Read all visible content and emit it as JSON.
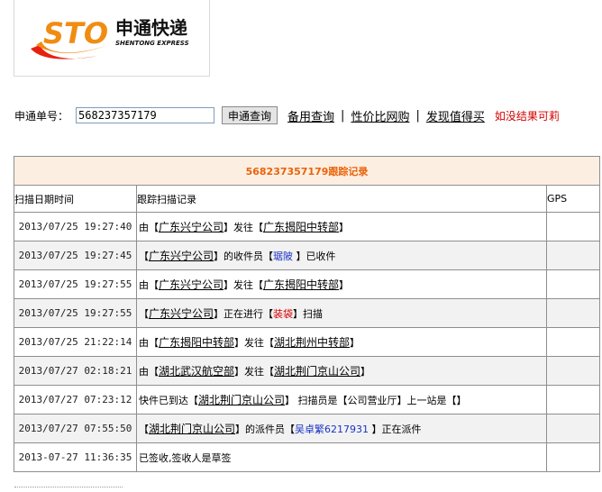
{
  "logo": {
    "mark": "STO",
    "name_cn": "申通快递",
    "name_en": "SHENTONG EXPRESS",
    "colors": {
      "orange": "#f08c12",
      "red": "#e8200f"
    }
  },
  "search": {
    "label": "申通单号：",
    "value": "568237357179",
    "button": "申通查询",
    "links": [
      "备用查询",
      "性价比网购",
      "发现值得买"
    ],
    "separators": [
      "|",
      "|"
    ],
    "tip": "如没结果可莉"
  },
  "table": {
    "title": "568237357179跟踪记录",
    "headers": {
      "date": "扫描日期时间",
      "record": "跟踪扫描记录",
      "gps": "GPS"
    },
    "rows": [
      {
        "date": "2013/07/25 19:27:40",
        "parts": [
          {
            "t": "由"
          },
          {
            "t": "【"
          },
          {
            "t": "广东兴宁公司",
            "link": true
          },
          {
            "t": "】发往【"
          },
          {
            "t": "广东揭阳中转部",
            "link": true
          },
          {
            "t": "】"
          }
        ]
      },
      {
        "date": "2013/07/25 19:27:45",
        "parts": [
          {
            "t": "【"
          },
          {
            "t": "广东兴宁公司",
            "link": true
          },
          {
            "t": "】的收件员【"
          },
          {
            "t": "琚陂",
            "blue": true
          },
          {
            "t": " 】已收件"
          }
        ]
      },
      {
        "date": "2013/07/25 19:27:55",
        "parts": [
          {
            "t": "由"
          },
          {
            "t": "【"
          },
          {
            "t": "广东兴宁公司",
            "link": true
          },
          {
            "t": "】发往【"
          },
          {
            "t": "广东揭阳中转部",
            "link": true
          },
          {
            "t": "】"
          }
        ]
      },
      {
        "date": "2013/07/25 19:27:55",
        "parts": [
          {
            "t": "【"
          },
          {
            "t": "广东兴宁公司",
            "link": true
          },
          {
            "t": "】正在进行【"
          },
          {
            "t": "装袋",
            "red": true
          },
          {
            "t": "】扫描"
          }
        ]
      },
      {
        "date": "2013/07/25 21:22:14",
        "parts": [
          {
            "t": "由"
          },
          {
            "t": "【"
          },
          {
            "t": "广东揭阳中转部",
            "link": true
          },
          {
            "t": "】发往【"
          },
          {
            "t": "湖北荆州中转部",
            "link": true
          },
          {
            "t": "】"
          }
        ]
      },
      {
        "date": "2013/07/27 02:18:21",
        "parts": [
          {
            "t": "由"
          },
          {
            "t": "【"
          },
          {
            "t": "湖北武汉航空部",
            "link": true
          },
          {
            "t": "】发往【"
          },
          {
            "t": "湖北荆门京山公司",
            "link": true
          },
          {
            "t": "】"
          }
        ]
      },
      {
        "date": "2013/07/27 07:23:12",
        "parts": [
          {
            "t": "快件已到达【"
          },
          {
            "t": "湖北荆门京山公司",
            "link": true
          },
          {
            "t": "】 扫描员是【公司营业厅】上一站是【】"
          }
        ]
      },
      {
        "date": "2013/07/27 07:55:50",
        "parts": [
          {
            "t": "【"
          },
          {
            "t": "湖北荆门京山公司",
            "link": true
          },
          {
            "t": "】的派件员【"
          },
          {
            "t": "吴卓繁6217931",
            "blue": true
          },
          {
            "t": " 】正在派件"
          }
        ]
      },
      {
        "date": "2013-07-27 11:36:35",
        "parts": [
          {
            "t": "已签收,签收人是草签"
          }
        ]
      }
    ]
  }
}
